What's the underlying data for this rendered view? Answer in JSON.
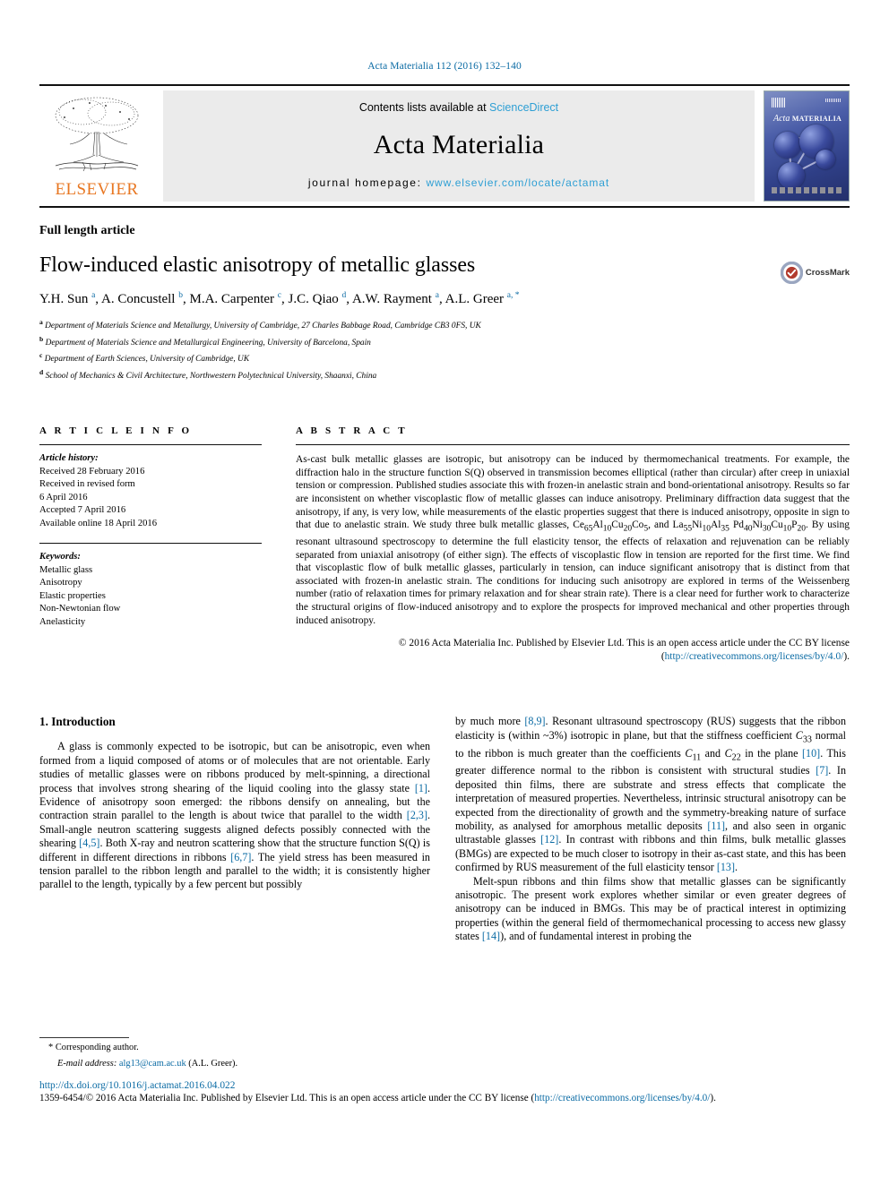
{
  "running_head": "Acta Materialia 112 (2016) 132–140",
  "masthead": {
    "contents_prefix": "Contents lists available at",
    "contents_link": "ScienceDirect",
    "journal_title": "Acta Materialia",
    "homepage_prefix": "journal homepage:",
    "homepage_url": "www.elsevier.com/locate/actamat",
    "publisher_logo_text": "ELSEVIER",
    "cover_title_italic": "Acta",
    "cover_title_small": "MATERIALIA",
    "link_color": "#2e9fd4"
  },
  "article": {
    "type": "Full length article",
    "title": "Flow-induced elastic anisotropy of metallic glasses",
    "crossmark_label": "CrossMark",
    "authors": [
      {
        "name": "Y.H. Sun",
        "sup": "a"
      },
      {
        "name": "A. Concustell",
        "sup": "b"
      },
      {
        "name": "M.A. Carpenter",
        "sup": "c"
      },
      {
        "name": "J.C. Qiao",
        "sup": "d"
      },
      {
        "name": "A.W. Rayment",
        "sup": "a"
      },
      {
        "name": "A.L. Greer",
        "sup": "a, *"
      }
    ],
    "affiliations": [
      {
        "mark": "a",
        "text": "Department of Materials Science and Metallurgy, University of Cambridge, 27 Charles Babbage Road, Cambridge CB3 0FS, UK"
      },
      {
        "mark": "b",
        "text": "Department of Materials Science and Metallurgical Engineering, University of Barcelona, Spain"
      },
      {
        "mark": "c",
        "text": "Department of Earth Sciences, University of Cambridge, UK"
      },
      {
        "mark": "d",
        "text": "School of Mechanics & Civil Architecture, Northwestern Polytechnical University, Shaanxi, China"
      }
    ]
  },
  "article_info": {
    "heading": "A R T I C L E   I N F O",
    "history_label": "Article history:",
    "history": [
      "Received 28 February 2016",
      "Received in revised form",
      "6 April 2016",
      "Accepted 7 April 2016",
      "Available online 18 April 2016"
    ],
    "keywords_label": "Keywords:",
    "keywords": [
      "Metallic glass",
      "Anisotropy",
      "Elastic properties",
      "Non-Newtonian flow",
      "Anelasticity"
    ]
  },
  "abstract": {
    "heading": "A B S T R A C T",
    "part1": "As-cast bulk metallic glasses are isotropic, but anisotropy can be induced by thermomechanical treatments. For example, the diffraction halo in the structure function S(Q) observed in transmission becomes elliptical (rather than circular) after creep in uniaxial tension or compression. Published studies associate this with frozen-in anelastic strain and bond-orientational anisotropy. Results so far are inconsistent on whether viscoplastic flow of metallic glasses can induce anisotropy. Preliminary diffraction data suggest that the anisotropy, if any, is very low, while measurements of the elastic properties suggest that there is induced anisotropy, opposite in sign to that due to anelastic strain. We study three bulk metallic glasses,",
    "formula1": "Ce65Al10Cu20Co5",
    "formula2": "La55Ni10Al35",
    "formula3": "Pd40Ni30Cu10P20",
    "part2": ", and",
    "part3": ". By using resonant ultrasound spectroscopy to determine the full elasticity tensor, the effects of relaxation and rejuvenation can be reliably separated from uniaxial anisotropy (of either sign). The effects of viscoplastic flow in tension are reported for the first time. We find that viscoplastic flow of bulk metallic glasses, particularly in tension, can induce significant anisotropy that is distinct from that associated with frozen-in anelastic strain. The conditions for inducing such anisotropy are explored in terms of the Weissenberg number (ratio of relaxation times for primary relaxation and for shear strain rate). There is a clear need for further work to characterize the structural origins of flow-induced anisotropy and to explore the prospects for improved mechanical and other properties through induced anisotropy.",
    "copyright": "© 2016 Acta Materialia Inc. Published by Elsevier Ltd. This is an open access article under the CC BY license (",
    "copyright_link": "http://creativecommons.org/licenses/by/4.0/",
    "copyright_end": ")."
  },
  "introduction": {
    "heading": "1. Introduction",
    "left_para_a": "A glass is commonly expected to be isotropic, but can be anisotropic, even when formed from a liquid composed of atoms or of molecules that are not orientable. Early studies of metallic glasses were on ribbons produced by melt-spinning, a directional process that involves strong shearing of the liquid cooling into the glassy state ",
    "ref1": "[1]",
    "left_para_b": ". Evidence of anisotropy soon emerged: the ribbons densify on annealing, but the contraction strain parallel to the length is about twice that parallel to the width ",
    "ref23": "[2,3]",
    "left_para_c": ". Small-angle neutron scattering suggests aligned defects possibly connected with the shearing ",
    "ref45": "[4,5]",
    "left_para_d": ". Both X-ray and neutron scattering show that the structure function S(Q) is different in different directions in ribbons ",
    "ref67": "[6,7]",
    "left_para_e": ". The yield stress has been measured in tension parallel to the ribbon length and parallel to the width; it is consistently higher parallel to the length, typically by a few percent but possibly",
    "right_para_a": "by much more ",
    "ref89": "[8,9]",
    "right_para_b": ". Resonant ultrasound spectroscopy (RUS) suggests that the ribbon elasticity is (within ~3%) isotropic in plane, but that the stiffness coefficient C33 normal to the ribbon is much greater than the coefficients C11 and C22 in the plane ",
    "ref10": "[10]",
    "right_para_c": ". This greater difference normal to the ribbon is consistent with structural studies ",
    "ref7": "[7]",
    "right_para_d": ". In deposited thin films, there are substrate and stress effects that complicate the interpretation of measured properties. Nevertheless, intrinsic structural anisotropy can be expected from the directionality of growth and the symmetry-breaking nature of surface mobility, as analysed for amorphous metallic deposits ",
    "ref11": "[11]",
    "right_para_e": ", and also seen in organic ultrastable glasses ",
    "ref12": "[12]",
    "right_para_f": ". In contrast with ribbons and thin films, bulk metallic glasses (BMGs) are expected to be much closer to isotropy in their as-cast state, and this has been confirmed by RUS measurement of the full elasticity tensor ",
    "ref13": "[13]",
    "right_para_g": ".",
    "right_para2_a": "Melt-spun ribbons and thin films show that metallic glasses can be significantly anisotropic. The present work explores whether similar or even greater degrees of anisotropy can be induced in BMGs. This may be of practical interest in optimizing properties (within the general field of thermomechanical processing to access new glassy states ",
    "ref14": "[14]",
    "right_para2_b": "), and of fundamental interest in probing the"
  },
  "footnote": {
    "star": "*",
    "corresponding": "Corresponding author.",
    "email_label": "E-mail address:",
    "email": "alg13@cam.ac.uk",
    "email_owner": "(A.L. Greer)."
  },
  "page_footer": {
    "doi": "http://dx.doi.org/10.1016/j.actamat.2016.04.022",
    "issn_line_a": "1359-6454/© 2016 Acta Materialia Inc. Published by Elsevier Ltd. This is an open access article under the CC BY license (",
    "issn_link": "http://creativecommons.org/licenses/by/4.0/",
    "issn_line_b": ")."
  }
}
